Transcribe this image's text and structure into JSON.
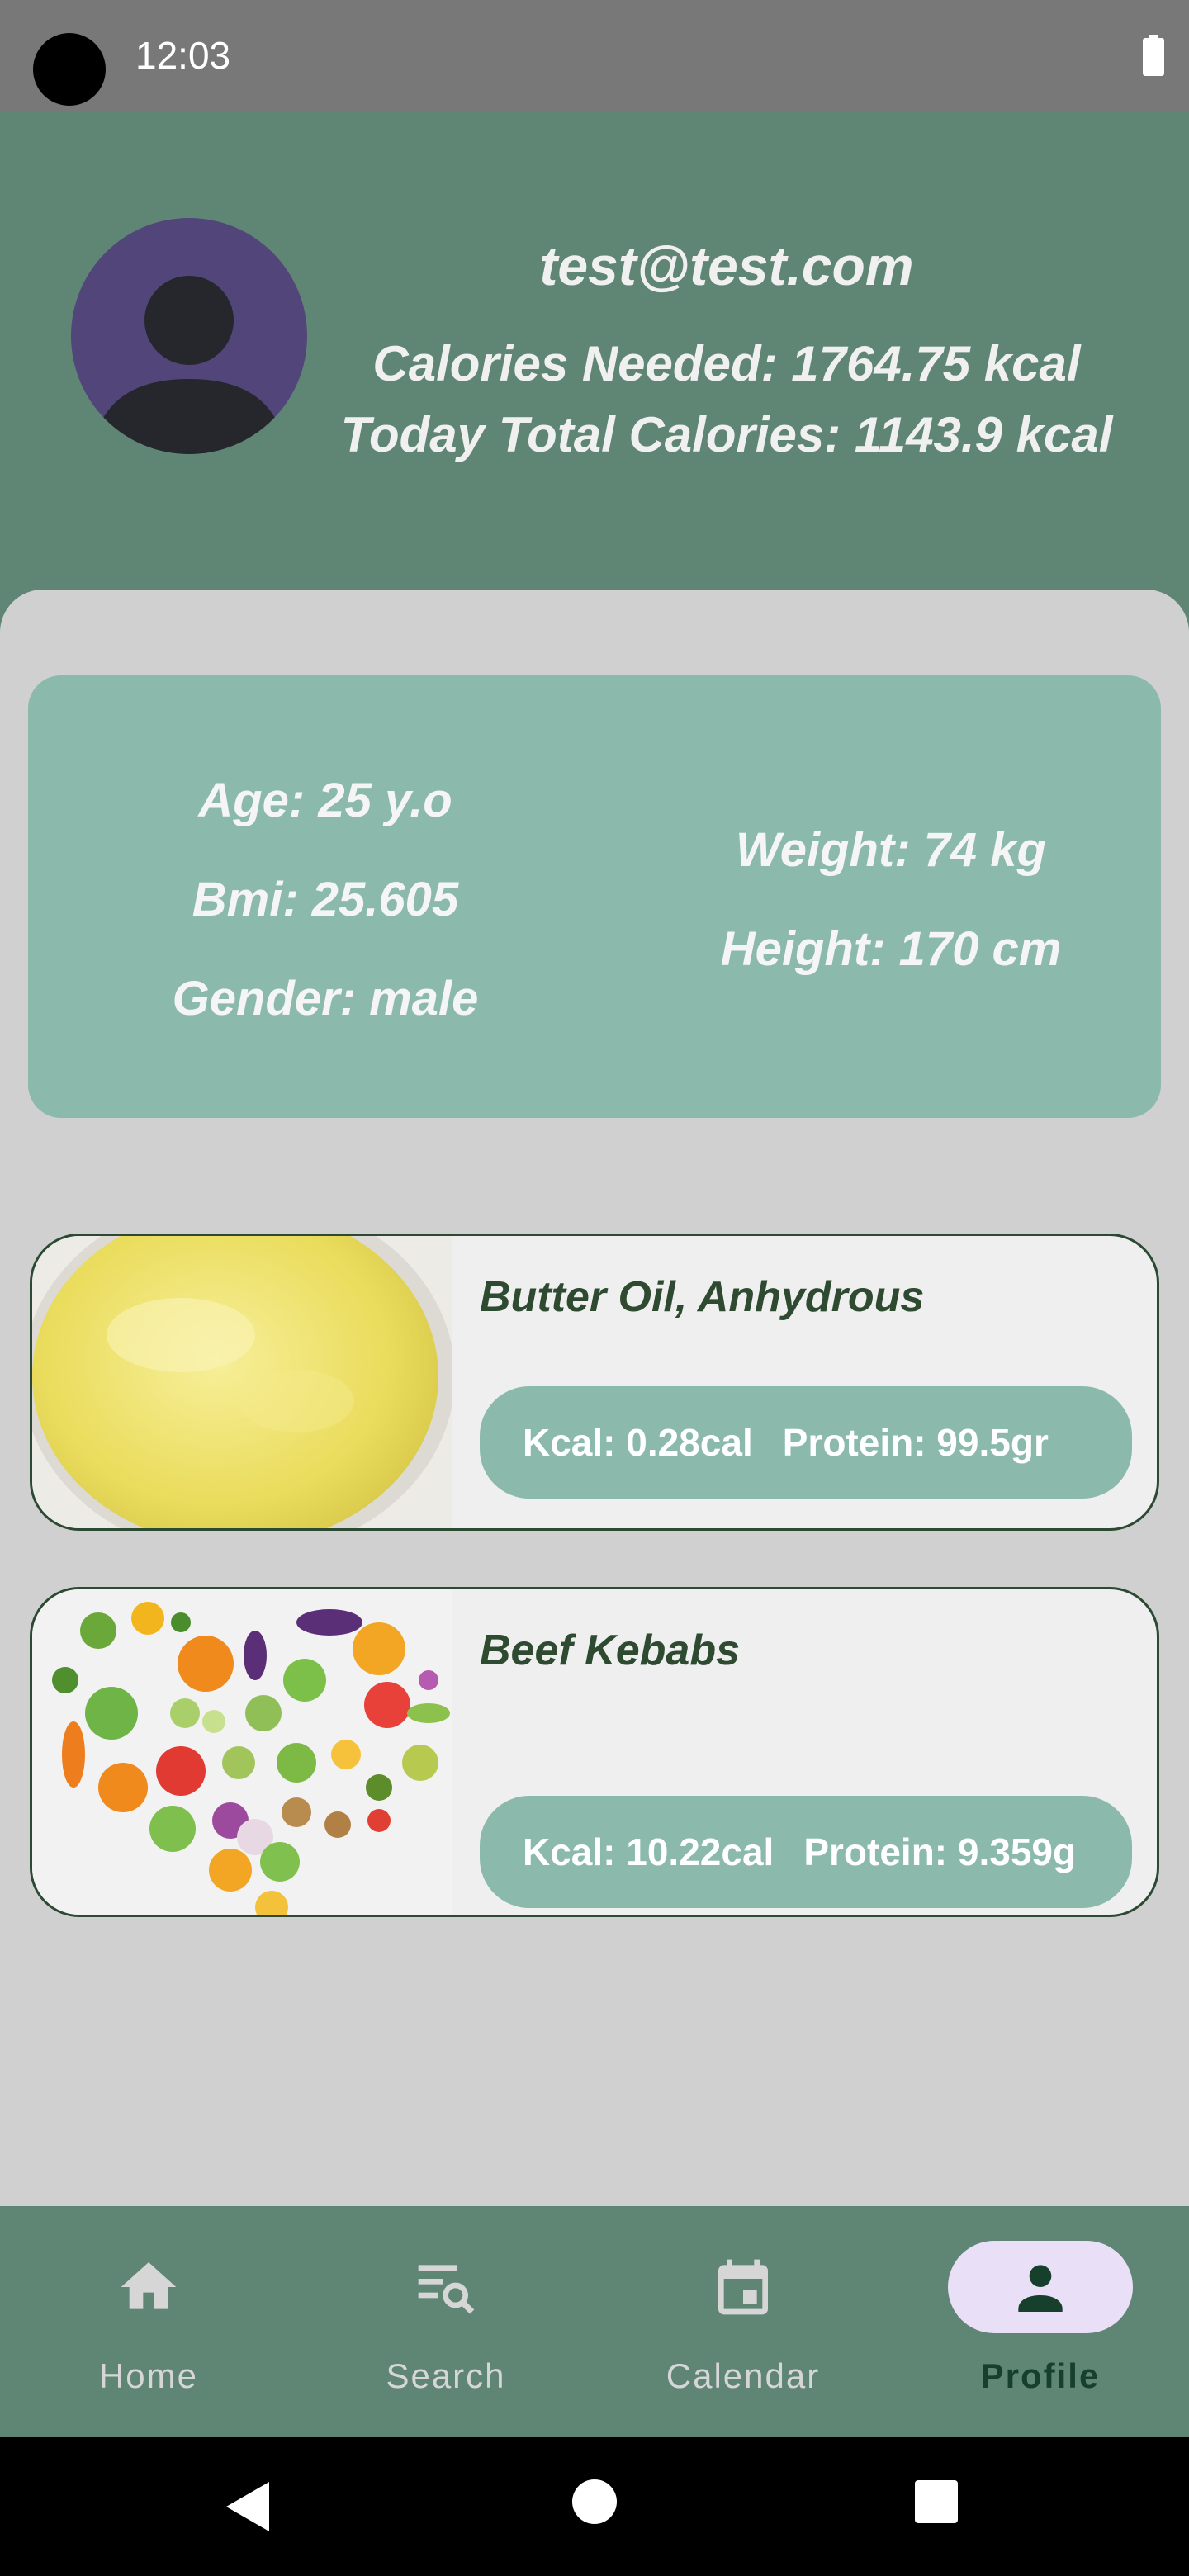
{
  "status_bar": {
    "time": "12:03"
  },
  "header": {
    "email": "test@test.com",
    "calories_needed": "Calories Needed: 1764.75 kcal",
    "today_total": "Today Total Calories: 1143.9 kcal"
  },
  "stats": {
    "age": "Age: 25 y.o",
    "bmi": "Bmi: 25.605",
    "gender": "Gender: male",
    "weight": "Weight:  74 kg",
    "height": "Height: 170 cm"
  },
  "foods": [
    {
      "name": "Butter Oil, Anhydrous",
      "kcal": "Kcal:  0.28cal",
      "protein": "Protein: 99.5gr"
    },
    {
      "name": "Beef Kebabs",
      "kcal": "Kcal:  10.22cal",
      "protein": "Protein: 9.359g"
    }
  ],
  "nav": {
    "items": [
      {
        "label": "Home",
        "icon": "home-icon"
      },
      {
        "label": "Search",
        "icon": "search-list-icon"
      },
      {
        "label": "Calendar",
        "icon": "calendar-icon"
      },
      {
        "label": "Profile",
        "icon": "person-icon",
        "active": true
      }
    ]
  },
  "colors": {
    "header": "#5f8575",
    "card": "#8bbaad",
    "avatar": "#524579",
    "active_nav": "#e9dff6"
  }
}
